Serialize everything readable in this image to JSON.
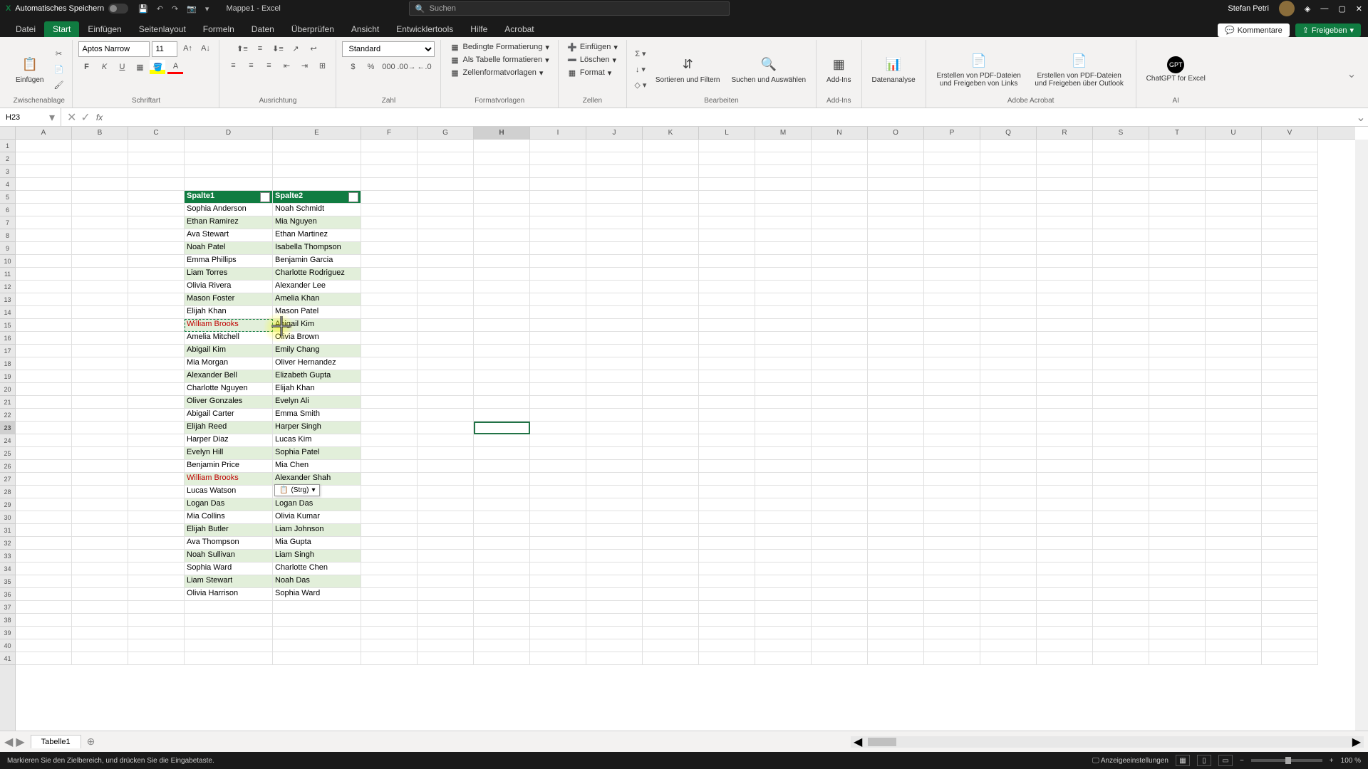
{
  "titlebar": {
    "autosave_label": "Automatisches Speichern",
    "doc_name": "Mappe1 - Excel",
    "search_placeholder": "Suchen",
    "user_name": "Stefan Petri"
  },
  "menu": {
    "tabs": [
      "Datei",
      "Start",
      "Einfügen",
      "Seitenlayout",
      "Formeln",
      "Daten",
      "Überprüfen",
      "Ansicht",
      "Entwicklertools",
      "Hilfe",
      "Acrobat"
    ],
    "active_index": 1,
    "comments": "Kommentare",
    "share": "Freigeben"
  },
  "ribbon": {
    "clipboard": {
      "paste": "Einfügen",
      "label": "Zwischenablage"
    },
    "font": {
      "name": "Aptos Narrow",
      "size": "11",
      "label": "Schriftart"
    },
    "align": {
      "label": "Ausrichtung"
    },
    "number": {
      "format": "Standard",
      "label": "Zahl"
    },
    "styles": {
      "cond": "Bedingte Formatierung",
      "table": "Als Tabelle formatieren",
      "cell": "Zellenformatvorlagen",
      "label": "Formatvorlagen"
    },
    "cells": {
      "insert": "Einfügen",
      "delete": "Löschen",
      "format": "Format",
      "label": "Zellen"
    },
    "editing": {
      "sort": "Sortieren und Filtern",
      "find": "Suchen und Auswählen",
      "label": "Bearbeiten"
    },
    "addins": {
      "addins": "Add-Ins",
      "label": "Add-Ins"
    },
    "data": {
      "analysis": "Datenanalyse"
    },
    "acrobat": {
      "pdf_links": "Erstellen von PDF-Dateien und Freigeben von Links",
      "pdf_outlook": "Erstellen von PDF-Dateien und Freigeben über Outlook",
      "label": "Adobe Acrobat"
    },
    "ai": {
      "gpt": "ChatGPT for Excel",
      "label": "AI"
    }
  },
  "namebox": {
    "ref": "H23"
  },
  "columns": [
    "A",
    "B",
    "C",
    "D",
    "E",
    "F",
    "G",
    "H",
    "I",
    "J",
    "K",
    "L",
    "M",
    "N",
    "O",
    "P",
    "Q",
    "R",
    "S",
    "T",
    "U",
    "V"
  ],
  "col_widths": {
    "default": 79,
    "D": 124,
    "E": 124
  },
  "grid": {
    "rows_visible": 41,
    "header_row": 5,
    "headers": {
      "d": "Spalte1",
      "e": "Spalte2"
    },
    "data": [
      {
        "d": "Sophia Anderson",
        "e": "Noah Schmidt"
      },
      {
        "d": "Ethan Ramirez",
        "e": "Mia Nguyen"
      },
      {
        "d": "Ava Stewart",
        "e": "Ethan Martinez"
      },
      {
        "d": "Noah Patel",
        "e": "Isabella Thompson"
      },
      {
        "d": "Emma Phillips",
        "e": "Benjamin Garcia"
      },
      {
        "d": "Liam Torres",
        "e": "Charlotte Rodriguez"
      },
      {
        "d": "Olivia Rivera",
        "e": "Alexander Lee"
      },
      {
        "d": "Mason Foster",
        "e": "Amelia Khan"
      },
      {
        "d": "Elijah Khan",
        "e": "Mason Patel"
      },
      {
        "d": "William Brooks",
        "e": "Abigail Kim"
      },
      {
        "d": "Amelia Mitchell",
        "e": "Olivia Brown"
      },
      {
        "d": "Abigail Kim",
        "e": "Emily Chang"
      },
      {
        "d": "Mia Morgan",
        "e": "Oliver Hernandez"
      },
      {
        "d": "Alexander Bell",
        "e": "Elizabeth Gupta"
      },
      {
        "d": "Charlotte Nguyen",
        "e": "Elijah Khan"
      },
      {
        "d": "Oliver Gonzales",
        "e": "Evelyn Ali"
      },
      {
        "d": "Abigail Carter",
        "e": "Emma Smith"
      },
      {
        "d": "Elijah Reed",
        "e": "Harper Singh"
      },
      {
        "d": "Harper Diaz",
        "e": "Lucas Kim"
      },
      {
        "d": "Evelyn Hill",
        "e": "Sophia Patel"
      },
      {
        "d": "Benjamin Price",
        "e": "Mia Chen"
      },
      {
        "d": "William Brooks",
        "e": "Alexander Shah"
      },
      {
        "d": "Lucas Watson",
        "e": ""
      },
      {
        "d": "Logan Das",
        "e": "Logan Das"
      },
      {
        "d": "Mia Collins",
        "e": "Olivia Kumar"
      },
      {
        "d": "Elijah Butler",
        "e": "Liam Johnson"
      },
      {
        "d": "Ava Thompson",
        "e": "Mia Gupta"
      },
      {
        "d": "Noah Sullivan",
        "e": "Liam Singh"
      },
      {
        "d": "Sophia Ward",
        "e": "Charlotte Chen"
      },
      {
        "d": "Liam Stewart",
        "e": "Noah Das"
      },
      {
        "d": "Olivia Harrison",
        "e": "Sophia Ward"
      }
    ],
    "red_rows_d": [
      15,
      27
    ],
    "active_cell": {
      "col": "H",
      "row": 23
    },
    "marching": {
      "col": "D",
      "row": 15
    },
    "paste_tag": "(Strg)"
  },
  "sheet": {
    "tab1": "Tabelle1"
  },
  "status": {
    "msg": "Markieren Sie den Zielbereich, und drücken Sie die Eingabetaste.",
    "display_settings": "Anzeigeeinstellungen",
    "zoom": "100 %"
  }
}
